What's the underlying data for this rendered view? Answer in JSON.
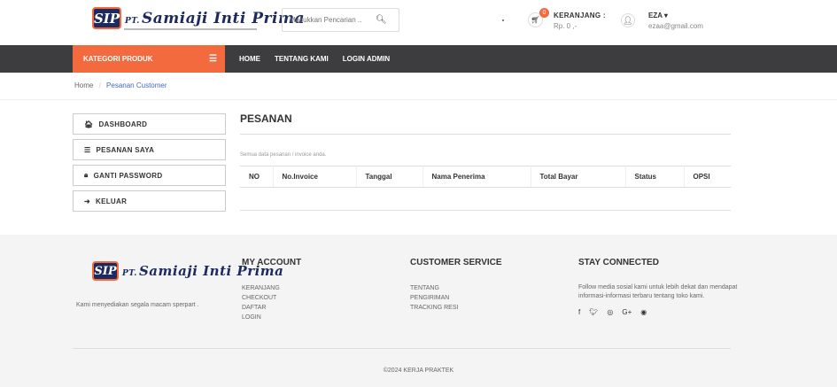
{
  "brand": {
    "badge": "SIP",
    "prefix": "PT.",
    "name": "Samiaji Inti Prima"
  },
  "search": {
    "placeholder": "Masukkan Pencarian ..",
    "icon": "search-icon"
  },
  "cart": {
    "count": "0",
    "label": "KERANJANG :",
    "amount": "Rp. 0 ,-"
  },
  "user": {
    "name": "EZA ▾",
    "email": "ezaa@gmail.com"
  },
  "nav": {
    "category_label": "KATEGORI PRODUK",
    "links": [
      "HOME",
      "TENTANG KAMI",
      "LOGIN ADMIN"
    ]
  },
  "breadcrumb": {
    "home": "Home",
    "separator": "/",
    "current": "Pesanan Customer"
  },
  "sidebar": {
    "items": [
      {
        "label": "DASHBOARD",
        "icon": "home-icon"
      },
      {
        "label": "PESANAN SAYA",
        "icon": "list-icon"
      },
      {
        "label": "GANTI PASSWORD",
        "icon": "lock-icon"
      },
      {
        "label": "KELUAR",
        "icon": "logout-icon"
      }
    ]
  },
  "main": {
    "title": "PESANAN",
    "note": "Semua data pesanan / invoice anda.",
    "columns": [
      "NO",
      "No.Invoice",
      "Tanggal",
      "Nama Penerima",
      "Total Bayar",
      "Status",
      "OPSI"
    ]
  },
  "footer": {
    "description": "Kami menyediakan segala macam sperpart .",
    "account": {
      "title": "MY ACCOUNT",
      "links": [
        "KERANJANG",
        "CHECKOUT",
        "DAFTAR",
        "LOGIN"
      ]
    },
    "service": {
      "title": "CUSTOMER SERVICE",
      "links": [
        "TENTANG",
        "PENGIRIMAN",
        "TRACKING RESI"
      ]
    },
    "connect": {
      "title": "STAY CONNECTED",
      "text": "Follow media sosial kami untuk lebih dekat dan mendapat informasi-informasi terbaru tentang toko kami.",
      "icons": [
        "facebook-icon",
        "twitter-icon",
        "instagram-icon",
        "google-plus-icon",
        "pinterest-icon"
      ]
    },
    "copyright": "©2024 KERJA PRAKTEK"
  },
  "colors": {
    "accent": "#f26a3e",
    "navbar": "#3d3d40",
    "brand": "#1c2a5e"
  }
}
